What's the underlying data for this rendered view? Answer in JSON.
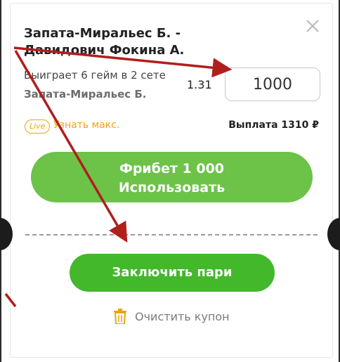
{
  "coupon": {
    "match_title": "Запата-Миральес Б. - Давидович Фокина А.",
    "bet_description": "Выиграет 6 гейм в 2 сете",
    "bet_player": "Запата-Миральес Б.",
    "odds": "1.31",
    "stake_value": "1000",
    "live_badge": "Live",
    "max_link": "Узнать макс.",
    "payout": "Выплата 1310 ₽",
    "freebet_line1": "Фрибет 1 000",
    "freebet_line2": "Использовать",
    "submit_label": "Заключить пари",
    "clear_label": "Очистить купон"
  },
  "icons": {
    "close": "close-icon",
    "clear": "trash-icon"
  },
  "colors": {
    "accent_green": "#42b82a",
    "freebet_green": "#6cc348",
    "live_orange": "#e8a60d",
    "annotation_red": "#b01e1e"
  }
}
